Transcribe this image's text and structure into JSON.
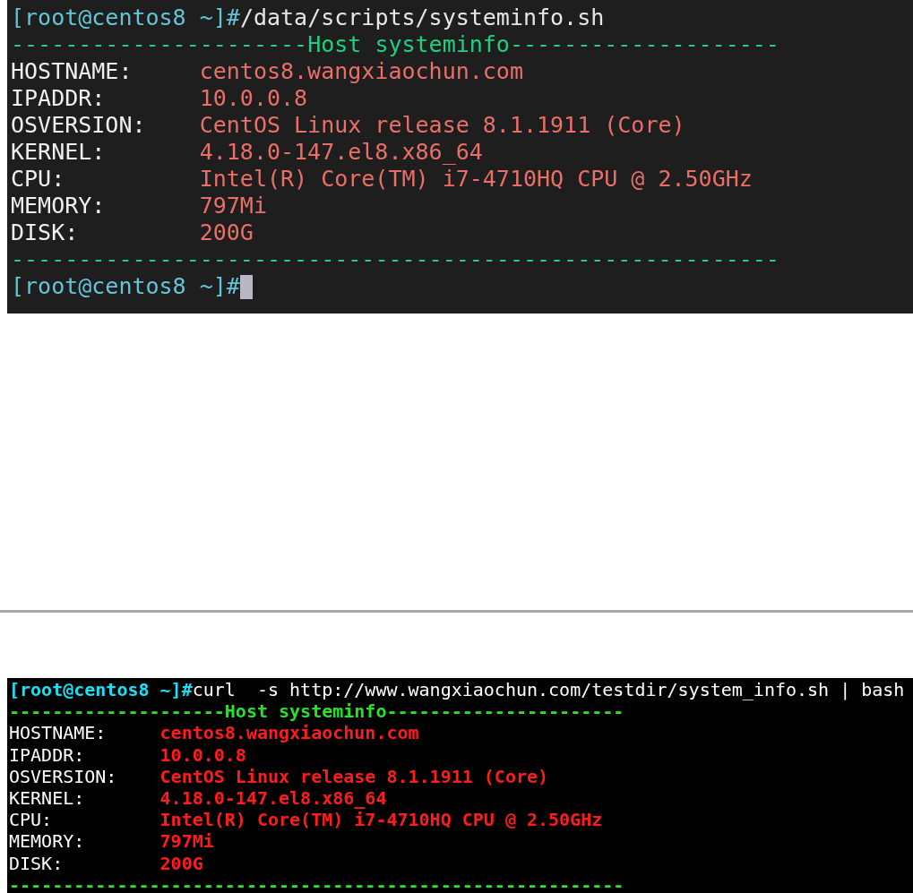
{
  "terminals": [
    {
      "kind": "gray",
      "prompt": "[root@centos8 ~]#",
      "command": "/data/scripts/systeminfo.sh",
      "header": "----------------------Host systeminfo--------------------",
      "rows": [
        {
          "label": "HOSTNAME:",
          "value": "centos8.wangxiaochun.com"
        },
        {
          "label": "IPADDR:",
          "value": "10.0.0.8"
        },
        {
          "label": "OSVERSION:",
          "value": "CentOS Linux release 8.1.1911 (Core)"
        },
        {
          "label": "KERNEL:",
          "value": "4.18.0-147.el8.x86_64"
        },
        {
          "label": "CPU:",
          "value": "Intel(R) Core(TM) i7-4710HQ CPU @ 2.50GHz"
        },
        {
          "label": "MEMORY:",
          "value": "797Mi"
        },
        {
          "label": "DISK:",
          "value": "200G"
        }
      ],
      "footer": "---------------------------------------------------------",
      "final_prompt": "[root@centos8 ~]#",
      "cursor": true
    },
    {
      "kind": "black",
      "prompt": "[root@centos8 ~]#",
      "command": "curl  -s http://www.wangxiaochun.com/testdir/system_info.sh | bash",
      "header": "--------------------Host systeminfo----------------------",
      "rows": [
        {
          "label": "HOSTNAME:",
          "value": "centos8.wangxiaochun.com"
        },
        {
          "label": "IPADDR:",
          "value": "10.0.0.8"
        },
        {
          "label": "OSVERSION:",
          "value": "CentOS Linux release 8.1.1911 (Core)"
        },
        {
          "label": "KERNEL:",
          "value": "4.18.0-147.el8.x86_64"
        },
        {
          "label": "CPU:",
          "value": "Intel(R) Core(TM) i7-4710HQ CPU @ 2.50GHz"
        },
        {
          "label": "MEMORY:",
          "value": "797Mi"
        },
        {
          "label": "DISK:",
          "value": "200G"
        }
      ],
      "footer": "---------------------------------------------------------"
    }
  ]
}
